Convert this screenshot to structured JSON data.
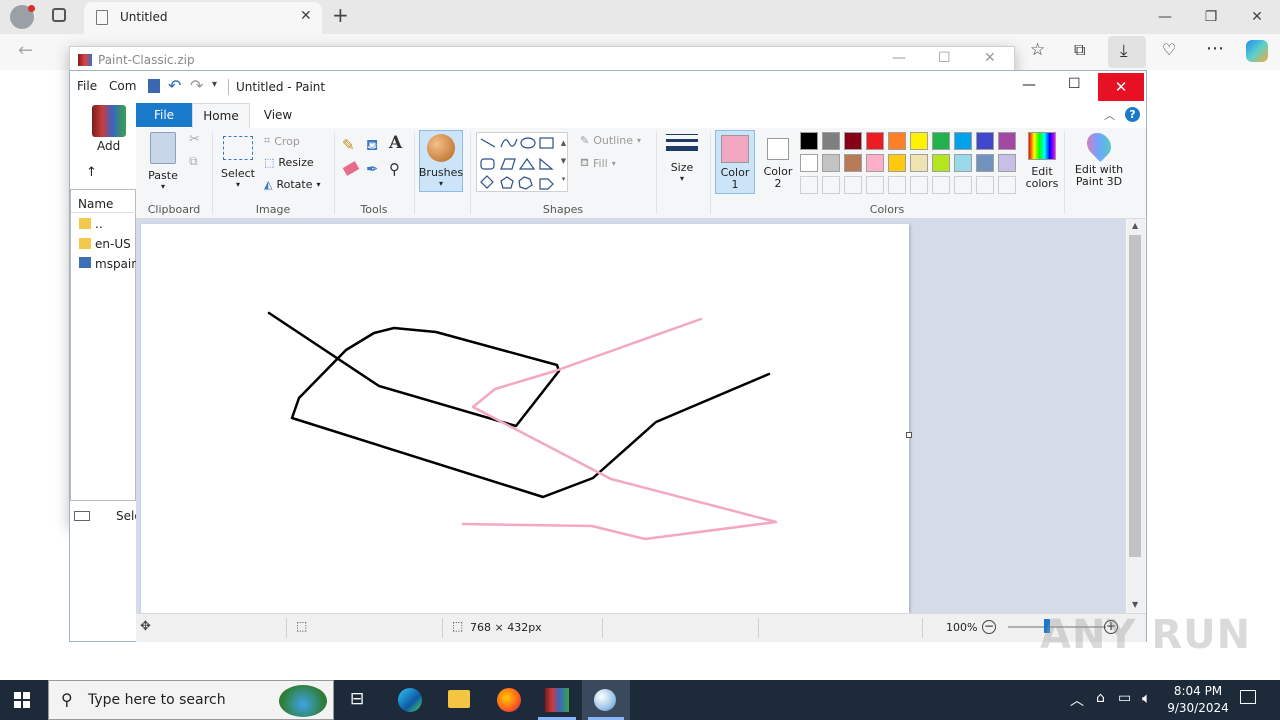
{
  "browser": {
    "tab_title": "Untitled",
    "new_tab": "+"
  },
  "winrar": {
    "title": "Paint-Classic.zip",
    "menu": [
      "File",
      "Com"
    ],
    "add_label": "Add",
    "name_header": "Name",
    "files": [
      "..",
      "en-US",
      "mspaint"
    ],
    "status": "Sele"
  },
  "paint": {
    "title": "Untitled - Paint",
    "tabs": {
      "file": "File",
      "home": "Home",
      "view": "View"
    },
    "clipboard": {
      "paste": "Paste",
      "label": "Clipboard"
    },
    "image": {
      "select": "Select",
      "crop": "Crop",
      "resize": "Resize",
      "rotate": "Rotate",
      "label": "Image"
    },
    "tools": {
      "label": "Tools"
    },
    "brushes": {
      "label": "Brushes"
    },
    "shapes": {
      "outline": "Outline",
      "fill": "Fill",
      "label": "Shapes"
    },
    "size": {
      "label": "Size"
    },
    "colors": {
      "color1": "Color",
      "color1_num": "1",
      "color2": "Color",
      "color2_num": "2",
      "edit_colors_1": "Edit",
      "edit_colors_2": "colors",
      "edit3d_1": "Edit with",
      "edit3d_2": "Paint 3D",
      "label": "Colors",
      "color1_value": "#f4a7c0",
      "color2_value": "#ffffff",
      "palette_row1": [
        "#000000",
        "#7f7f7f",
        "#880015",
        "#ed1c24",
        "#ff7f27",
        "#fff200",
        "#22b14c",
        "#00a2e8",
        "#3f48cc",
        "#a349a4"
      ],
      "palette_row2": [
        "#ffffff",
        "#c3c3c3",
        "#b97a57",
        "#ffaec9",
        "#ffc90e",
        "#efe4b0",
        "#b5e61d",
        "#99d9ea",
        "#7092be",
        "#c8bfe7"
      ]
    },
    "status": {
      "dimensions": "768 × 432px",
      "zoom": "100%"
    },
    "drawing": {
      "black_stroke": "#000000",
      "pink_stroke": "#f4a7c0"
    }
  },
  "taskbar": {
    "search_placeholder": "Type here to search",
    "time": "8:04 PM",
    "date": "9/30/2024"
  },
  "watermark": "ANY RUN"
}
